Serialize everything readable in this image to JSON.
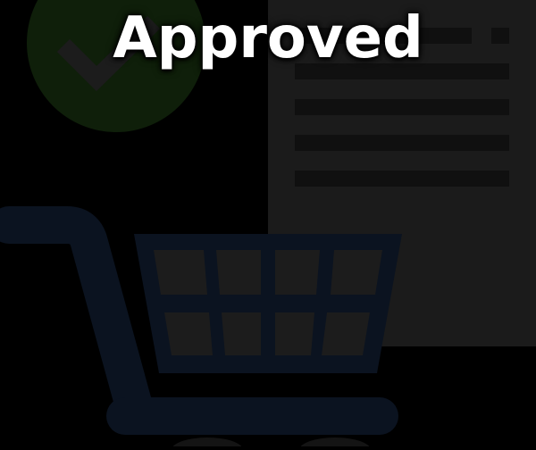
{
  "overlay": {
    "status_text": "Approved"
  },
  "icons": {
    "badge": "checkmark-badge-icon",
    "document": "document-icon",
    "cart": "shopping-cart-icon"
  },
  "colors": {
    "background": "#000000",
    "badge_fill": "#0f1f0a",
    "checkmark": "#1c1c1c",
    "document_fill": "#1b1b1b",
    "document_lines": "#101010",
    "cart_frame": "#0b1320",
    "cart_cells": "#1c1c1c",
    "text": "#ffffff"
  }
}
